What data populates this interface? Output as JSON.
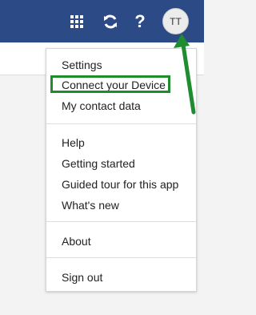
{
  "header": {
    "avatar_initials": "TT",
    "help_label": "?"
  },
  "menu": {
    "group1": [
      "Settings",
      "Connect your Device",
      "My contact data"
    ],
    "group2": [
      "Help",
      "Getting started",
      "Guided tour for this app",
      "What's new"
    ],
    "group3": [
      "About"
    ],
    "group4": [
      "Sign out"
    ]
  },
  "colors": {
    "header_bg": "#2c4a85",
    "annotation": "#1f8c2f"
  },
  "icons": {
    "apps": "apps-grid-icon",
    "refresh": "refresh-icon",
    "help": "help-icon",
    "annotation_arrow": "arrow-icon"
  }
}
